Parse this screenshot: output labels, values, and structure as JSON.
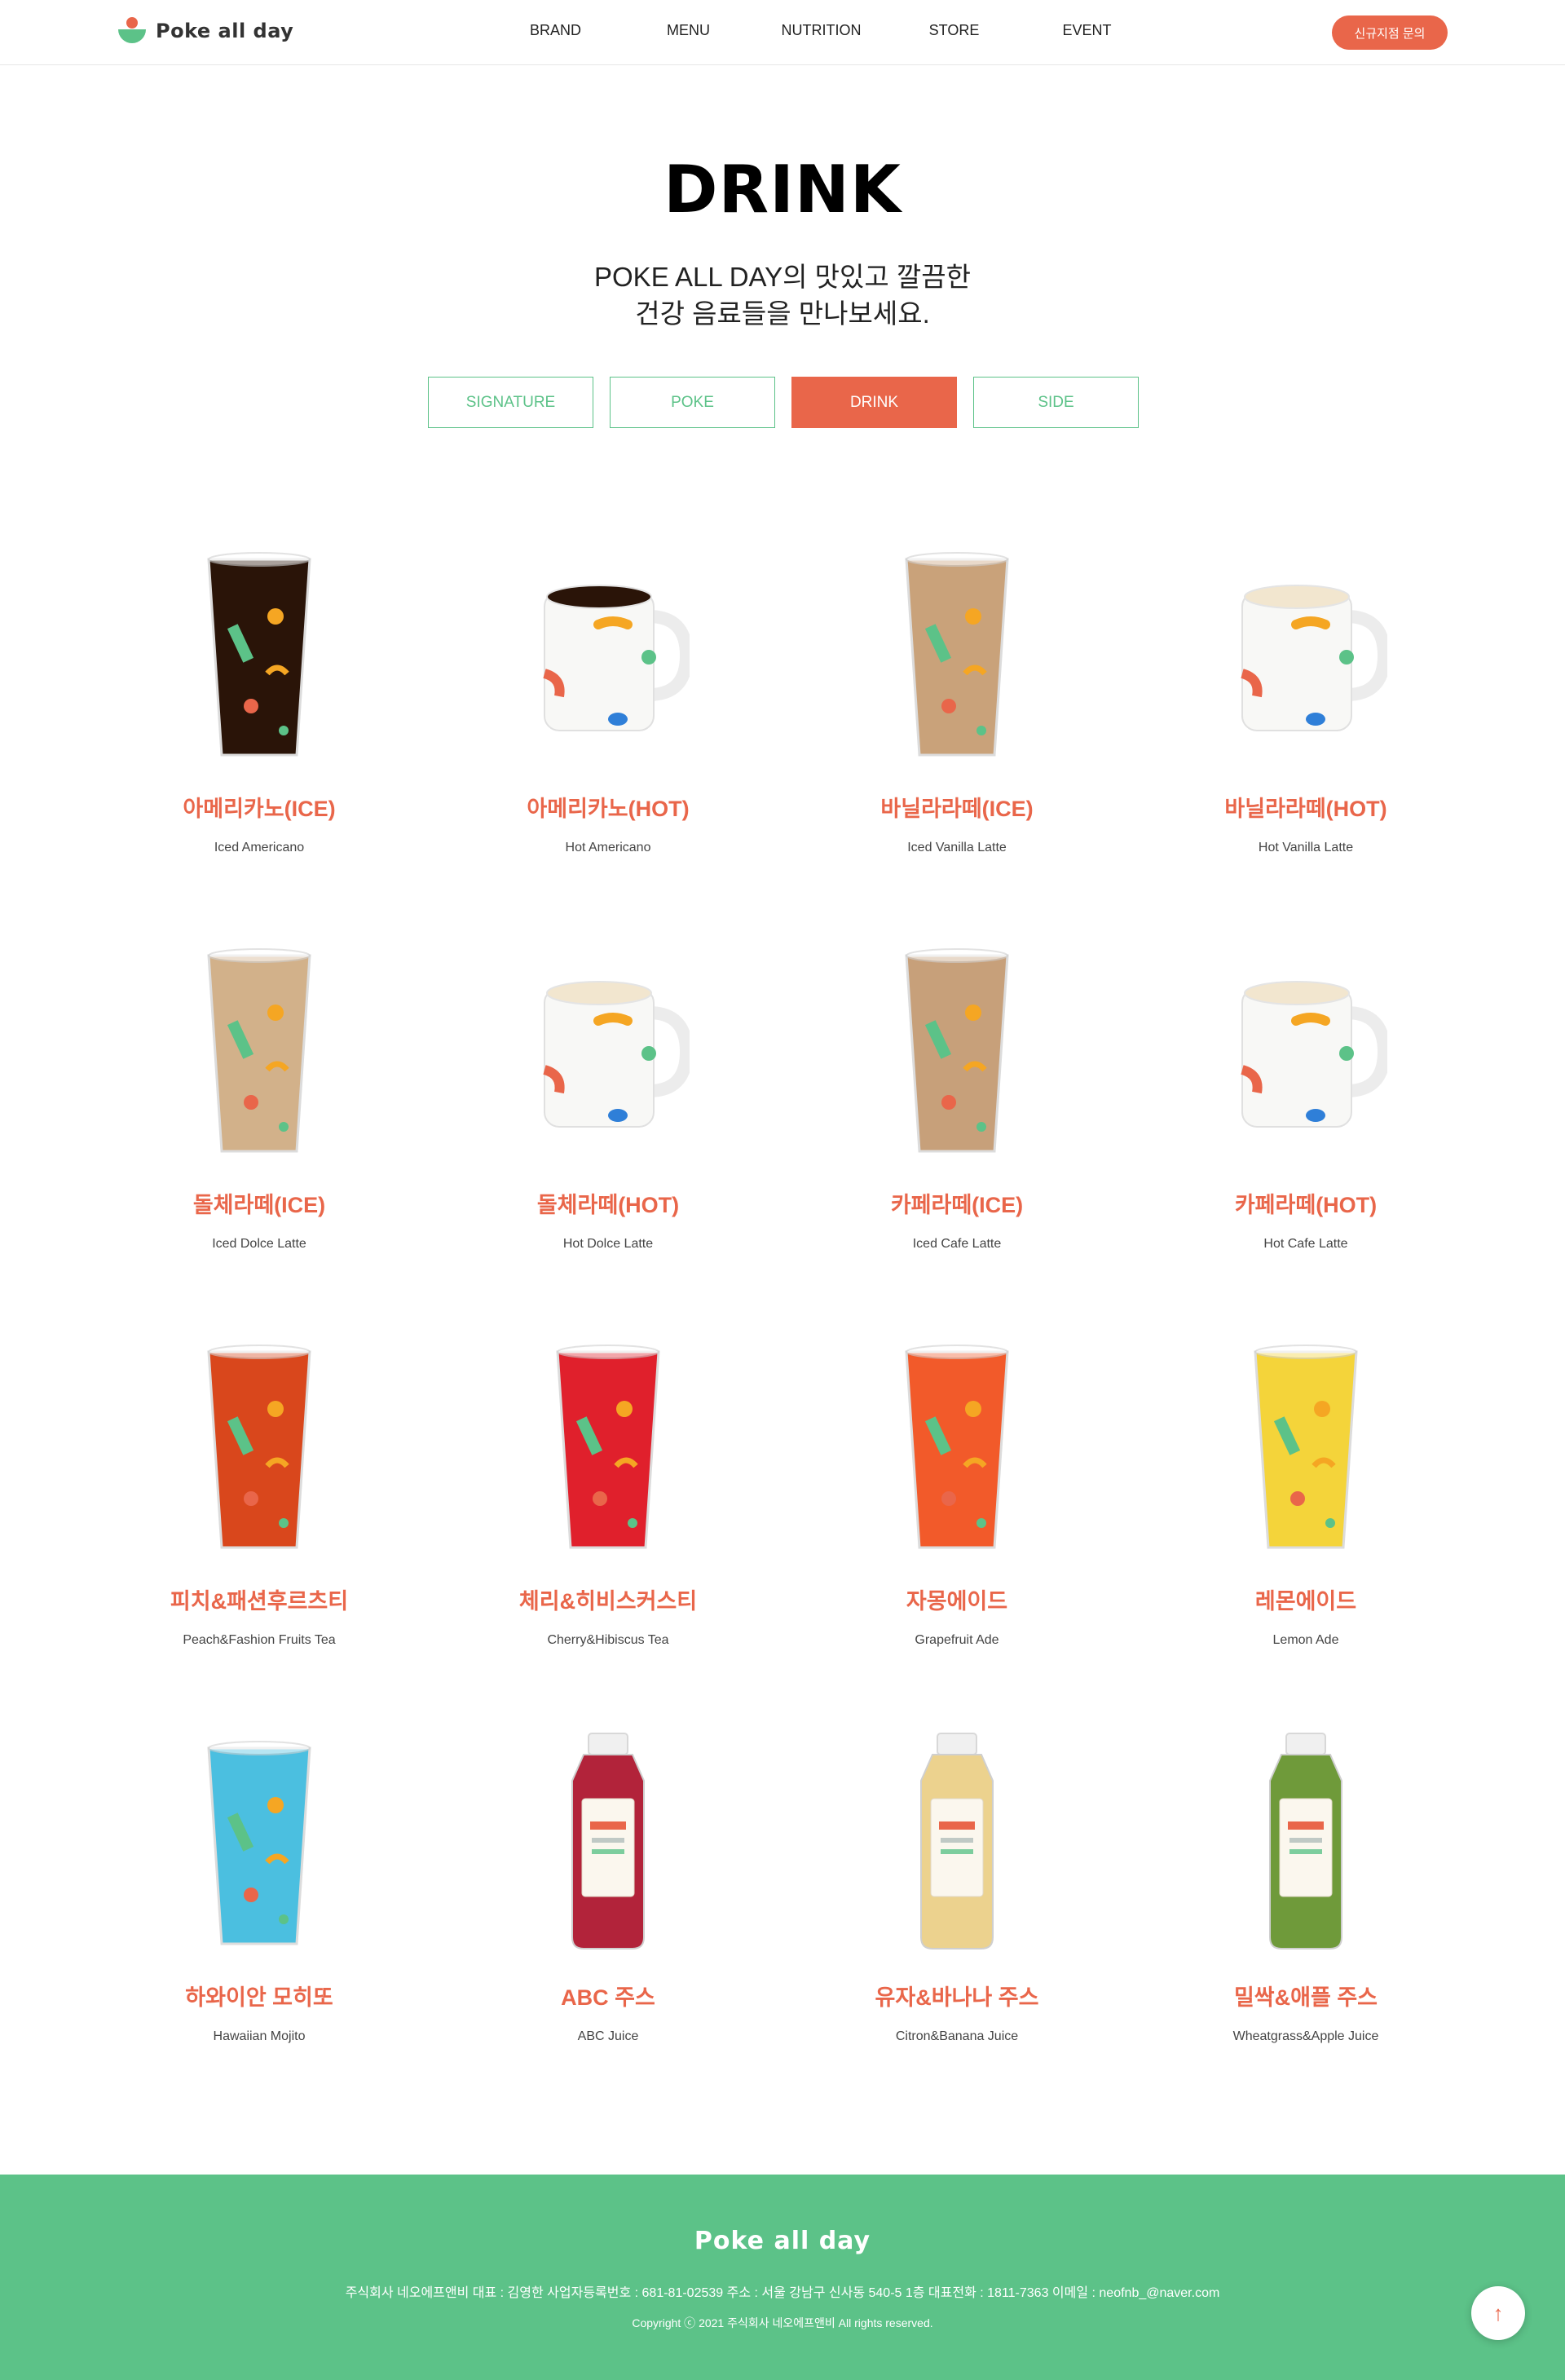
{
  "header": {
    "logo_text": "Poke all day",
    "nav": [
      "BRAND",
      "MENU",
      "NUTRITION",
      "STORE",
      "EVENT"
    ],
    "cta_label": "신규지점 문의"
  },
  "hero": {
    "title": "DRINK",
    "subtitle_line1": "POKE ALL DAY의 맛있고 깔끔한",
    "subtitle_line2": "건강 음료들을 만나보세요."
  },
  "tabs": [
    {
      "label": "SIGNATURE",
      "active": false
    },
    {
      "label": "POKE",
      "active": false
    },
    {
      "label": "DRINK",
      "active": true
    },
    {
      "label": "SIDE",
      "active": false
    }
  ],
  "items": [
    {
      "ko": "아메리카노(ICE)",
      "en": "Iced Americano",
      "kind": "iced-cup",
      "liquid": "#2a1408"
    },
    {
      "ko": "아메리카노(HOT)",
      "en": "Hot Americano",
      "kind": "mug",
      "liquid": "#2a1408"
    },
    {
      "ko": "바닐라라떼(ICE)",
      "en": "Iced Vanilla Latte",
      "kind": "iced-cup",
      "liquid": "#c9a27a"
    },
    {
      "ko": "바닐라라떼(HOT)",
      "en": "Hot Vanilla Latte",
      "kind": "mug",
      "liquid": "#f2e6cf"
    },
    {
      "ko": "돌체라떼(ICE)",
      "en": "Iced Dolce Latte",
      "kind": "iced-cup",
      "liquid": "#d2b18a"
    },
    {
      "ko": "돌체라떼(HOT)",
      "en": "Hot Dolce Latte",
      "kind": "mug",
      "liquid": "#f2e6cf"
    },
    {
      "ko": "카페라떼(ICE)",
      "en": "Iced Cafe Latte",
      "kind": "iced-cup",
      "liquid": "#c7a07a"
    },
    {
      "ko": "카페라떼(HOT)",
      "en": "Hot Cafe Latte",
      "kind": "mug",
      "liquid": "#f2e6cf"
    },
    {
      "ko": "피치&패션후르츠티",
      "en": "Peach&Fashion Fruits Tea",
      "kind": "iced-cup",
      "liquid": "#d9471c"
    },
    {
      "ko": "체리&히비스커스티",
      "en": "Cherry&Hibiscus Tea",
      "kind": "iced-cup",
      "liquid": "#e0202c"
    },
    {
      "ko": "자몽에이드",
      "en": "Grapefruit Ade",
      "kind": "iced-cup",
      "liquid": "#f25a2a"
    },
    {
      "ko": "레몬에이드",
      "en": "Lemon Ade",
      "kind": "iced-cup",
      "liquid": "#f4d43a"
    },
    {
      "ko": "하와이안 모히또",
      "en": "Hawaiian Mojito",
      "kind": "iced-cup",
      "liquid": "#4bbfe0"
    },
    {
      "ko": "ABC 주스",
      "en": "ABC Juice",
      "kind": "bottle",
      "liquid": "#b2233a"
    },
    {
      "ko": "유자&바나나 주스",
      "en": "Citron&Banana Juice",
      "kind": "bottle",
      "liquid": "#ecd28e"
    },
    {
      "ko": "밀싹&애플 주스",
      "en": "Wheatgrass&Apple Juice",
      "kind": "bottle",
      "liquid": "#6f9a3a"
    }
  ],
  "footer": {
    "logo_text": "Poke all day",
    "info": "주식회사 네오에프앤비 대표 : 김영한 사업자등록번호 : 681-81-02539 주소 : 서울 강남구 신사동 540-5 1층 대표전화 : 1811-7363 이메일 : neofnb_@naver.com",
    "copyright": "Copyright ⓒ 2021 주식회사 네오에프앤비 All rights reserved."
  },
  "colors": {
    "accent": "#e9664a",
    "green": "#5cc288"
  },
  "icons": {
    "to_top": "arrow-up-icon"
  }
}
